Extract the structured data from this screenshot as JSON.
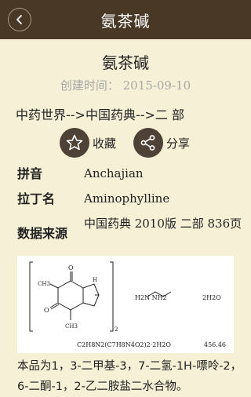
{
  "header": {
    "title": "氨茶碱"
  },
  "article": {
    "title": "氨茶碱",
    "created": "创建时间：  2015-09-10",
    "breadcrumb": "中药世界-->中国药典-->二 部"
  },
  "actions": {
    "favorite_label": "收藏",
    "share_label": "分享"
  },
  "fields": [
    {
      "label": "拼音",
      "value": "Anchajian"
    },
    {
      "label": "拉丁名",
      "value": "Aminophylline"
    },
    {
      "label": "数据来源",
      "value": "中国药典 2010版 二部 836页"
    }
  ],
  "formula": {
    "left_labels": {
      "n_top": "N",
      "h": "H",
      "ch3_1": "CH3",
      "ch3_2": "CH3",
      "o_top": "O",
      "o_left": "O",
      "n1": "N",
      "n2": "N",
      "n3": "N"
    },
    "subscript": "2",
    "ethylenediamine": "H2N     NH2",
    "water": "2H2O",
    "molecular": "C2H8N2(C7H8N4O2)2·2H2O",
    "weight": "456.46"
  },
  "description": "本品为1，3-二甲基-3，7-二氢-1H-嘌呤-2，6-二酮-1，2-乙二胺盐二水合物。",
  "colors": {
    "header_bg": "#4a3826",
    "page_bg": "#f6f0d6",
    "icon_circle": "#4e4136",
    "muted": "#a7a7a7"
  }
}
